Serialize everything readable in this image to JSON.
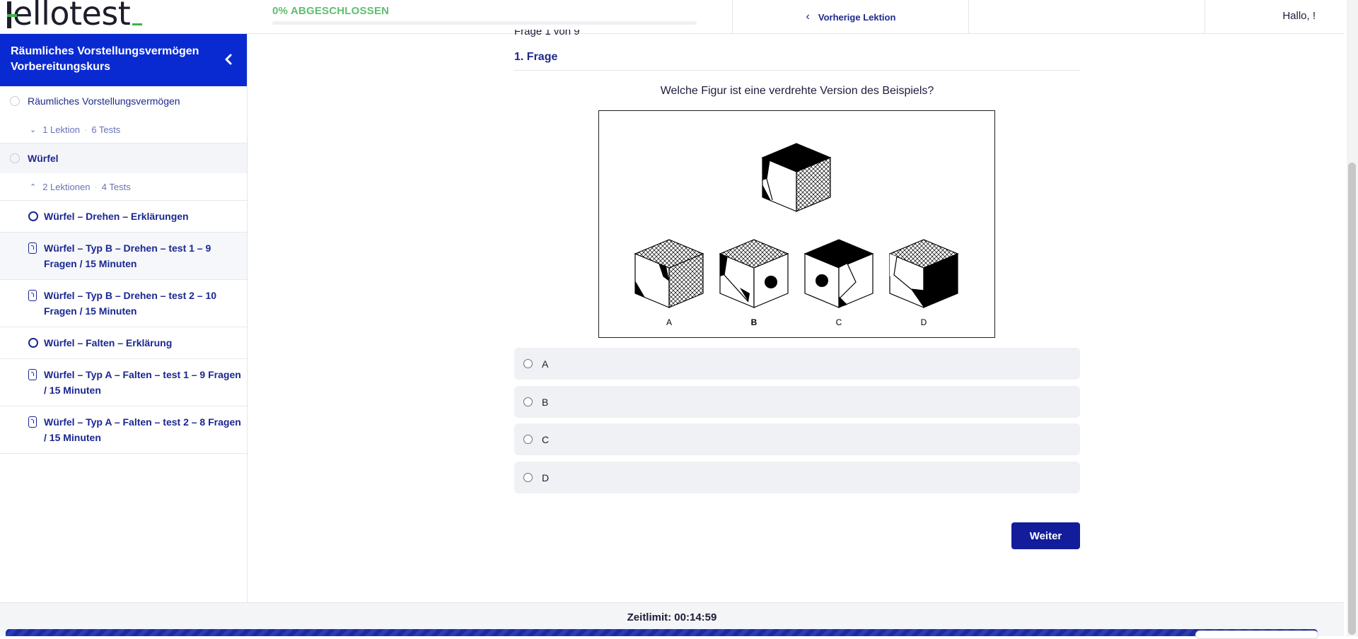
{
  "header": {
    "logo_text": "Hellotest",
    "progress_label": "0% ABGESCHLOSSEN",
    "progress_fraction": 0.0,
    "prev_lesson_label": "Vorherige Lektion",
    "greeting": "Hallo, !"
  },
  "sidebar": {
    "course_title": "Räumliches Vorstellungsvermögen Vorbereitungskurs",
    "sections": [
      {
        "title": "Räumliches Vorstellungsvermögen",
        "lessons": "1 Lektion",
        "tests": "6 Tests",
        "expanded": false
      },
      {
        "title": "Würfel",
        "lessons": "2 Lektionen",
        "tests": "4 Tests",
        "expanded": true
      }
    ],
    "lessons": [
      {
        "label": "Würfel – Drehen – Erklärungen",
        "icon": "circle-icon"
      },
      {
        "label": "Würfel – Typ B – Drehen – test 1 – 9 Fragen / 15 Minuten",
        "icon": "quiz-icon"
      },
      {
        "label": "Würfel – Typ B – Drehen – test 2 – 10 Fragen / 15 Minuten",
        "icon": "quiz-icon"
      },
      {
        "label": "Würfel – Falten – Erklärung",
        "icon": "circle-icon"
      },
      {
        "label": "Würfel – Typ A – Falten – test 1 – 9 Fragen / 15 Minuten",
        "icon": "quiz-icon"
      },
      {
        "label": "Würfel – Typ A – Falten – test 2 – 8 Fragen / 15 Minuten",
        "icon": "quiz-icon"
      }
    ]
  },
  "quiz": {
    "question_counter": "Frage 1 von 9",
    "question_title": "1. Frage",
    "question_text": "Welche Figur ist eine verdrehte Version des Beispiels?",
    "figure_labels": [
      "A",
      "B",
      "C",
      "D"
    ],
    "options": [
      "A",
      "B",
      "C",
      "D"
    ],
    "next_label": "Weiter"
  },
  "footer": {
    "timer": "Zeitlimit: 00:14:59"
  },
  "colors": {
    "brand_blue": "#0a2ad1",
    "nav_text": "#1d2a8c",
    "progress_green": "#5fbf6e",
    "button": "#131c9a"
  }
}
